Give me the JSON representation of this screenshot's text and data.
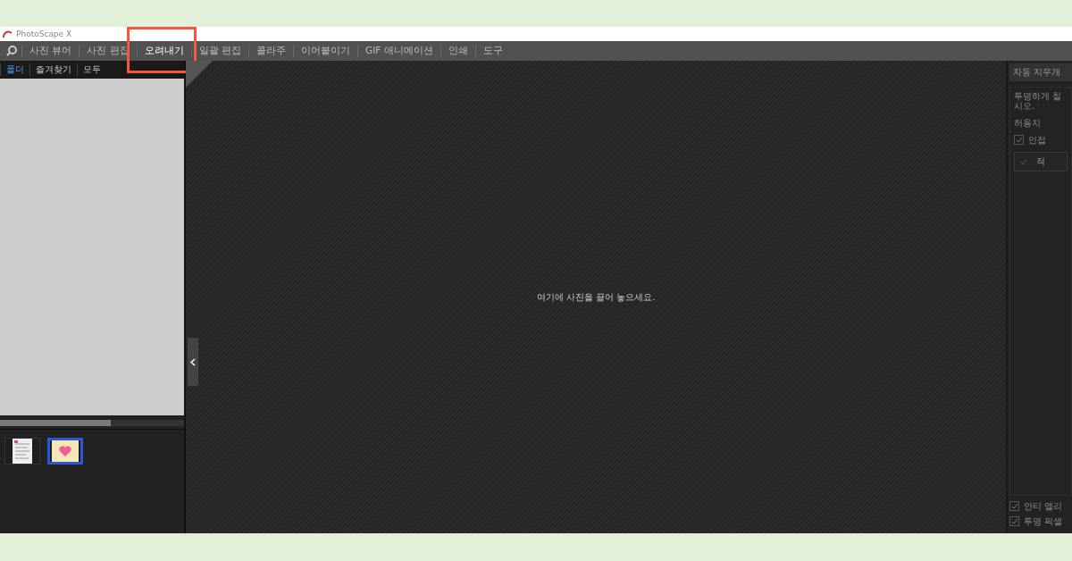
{
  "window": {
    "title": "PhotoScape X"
  },
  "menu": [
    {
      "label": "사진 뷰어",
      "selected": false
    },
    {
      "label": "사진 편집",
      "selected": false
    },
    {
      "label": "오려내기",
      "selected": true
    },
    {
      "label": "일괄 편집",
      "selected": false
    },
    {
      "label": "콜라주",
      "selected": false
    },
    {
      "label": "이어붙이기",
      "selected": false
    },
    {
      "label": "GIF 애니메이션",
      "selected": false
    },
    {
      "label": "인쇄",
      "selected": false
    },
    {
      "label": "도구",
      "selected": false
    }
  ],
  "sidebar": {
    "tabs": [
      {
        "label": "폴더",
        "selected": true
      },
      {
        "label": "즐겨찾기",
        "selected": false
      },
      {
        "label": "모두",
        "selected": false
      }
    ],
    "thumbnails": [
      {
        "kind": "document",
        "selected": false
      },
      {
        "kind": "heart",
        "selected": true
      }
    ]
  },
  "canvas": {
    "message": "여기에 사진을 끌어 놓으세요."
  },
  "right_panel": {
    "tool_button": "자동 지우개",
    "hint": "투명하게 칠\n시오.",
    "tolerance": "허용치",
    "adjacent": {
      "label": "인접",
      "checked": true
    },
    "apply_button": "적",
    "options": [
      {
        "label": "안티 앨리",
        "checked": true
      },
      {
        "label": "투명 픽셀",
        "checked": true
      }
    ]
  }
}
